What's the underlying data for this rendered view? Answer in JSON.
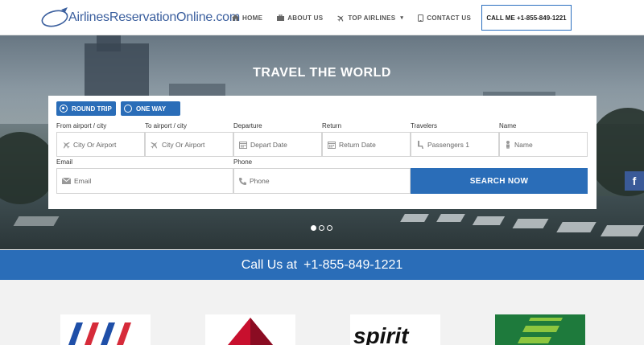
{
  "header": {
    "logo_text": "AirlinesReservationOnline.com",
    "nav": [
      {
        "label": "HOME",
        "icon": "home-icon"
      },
      {
        "label": "ABOUT US",
        "icon": "briefcase-icon"
      },
      {
        "label": "TOP AIRLINES",
        "icon": "plane-icon"
      },
      {
        "label": "CONTACT US",
        "icon": "phone-icon"
      }
    ],
    "callme": "CALL ME +1-855-849-1221"
  },
  "hero": {
    "title": "TRAVEL THE WORLD",
    "slides": 3,
    "active_slide": 1
  },
  "booking": {
    "trip_types": [
      {
        "label": "ROUND TRIP",
        "selected": true
      },
      {
        "label": "ONE WAY",
        "selected": false
      }
    ],
    "fields": {
      "from": {
        "label": "From airport / city",
        "placeholder": "City Or Airport"
      },
      "to": {
        "label": "To airport / city",
        "placeholder": "City Or Airport"
      },
      "departure": {
        "label": "Departure",
        "placeholder": "Depart Date"
      },
      "return": {
        "label": "Return",
        "placeholder": "Return Date"
      },
      "travelers": {
        "label": "Travelers",
        "value": "Passengers 1"
      },
      "name": {
        "label": "Name",
        "placeholder": "Name"
      },
      "email": {
        "label": "Email",
        "placeholder": "Email"
      },
      "phone": {
        "label": "Phone",
        "placeholder": "Phone"
      }
    },
    "search_label": "SEARCH NOW"
  },
  "callbar": {
    "prefix": "Call Us at",
    "phone": "+1-855-849-1221"
  },
  "social": {
    "facebook": "f"
  },
  "colors": {
    "primary": "#2a6db8",
    "logo_blue": "#3b5f9e",
    "facebook": "#3a5a98"
  }
}
